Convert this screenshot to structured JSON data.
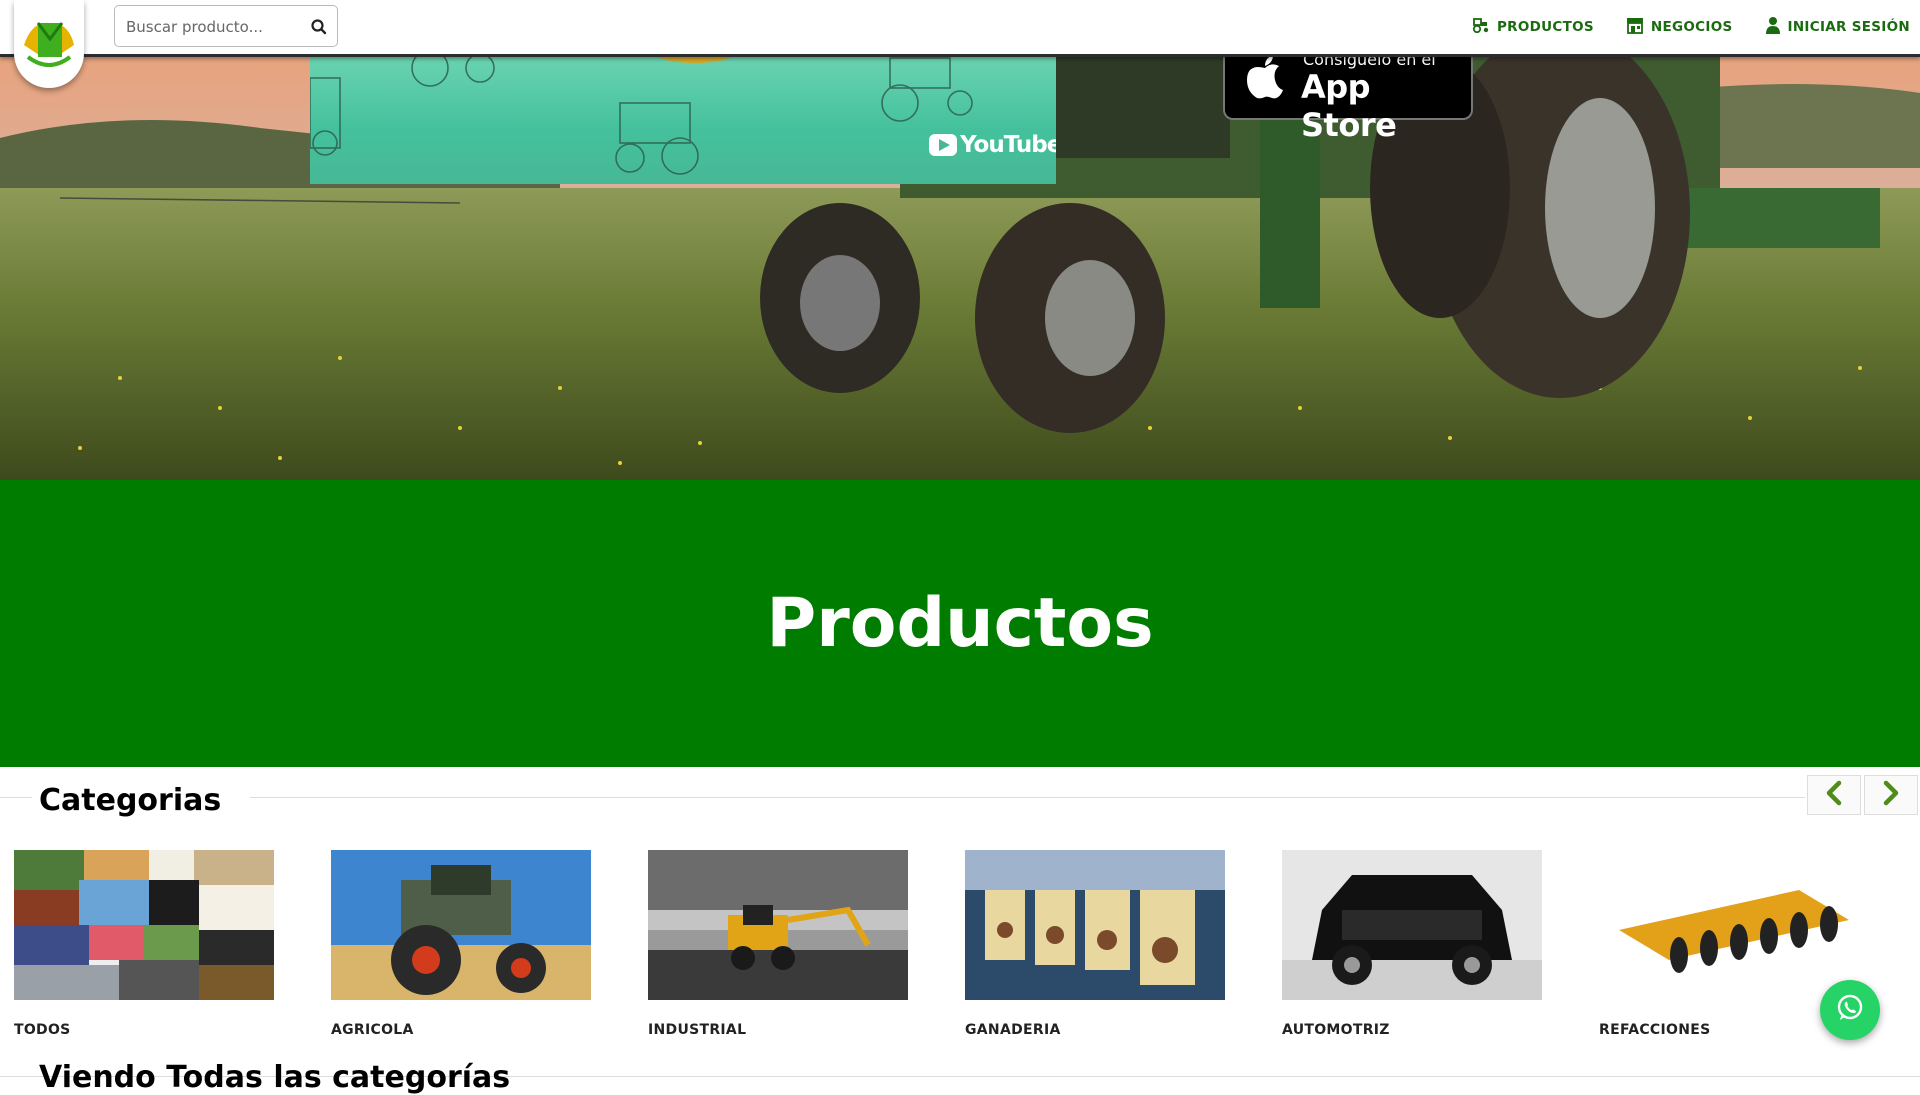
{
  "header": {
    "search_placeholder": "Buscar producto...",
    "nav": [
      {
        "label": "PRODUCTOS",
        "icon": "tractor-icon"
      },
      {
        "label": "NEGOCIOS",
        "icon": "store-icon"
      },
      {
        "label": "INICIAR SESIÓN",
        "icon": "user-icon"
      }
    ]
  },
  "hero": {
    "video_brand": "YouTube",
    "appstore_top": "Consíguelo en el",
    "appstore_main": "App Store"
  },
  "banner": {
    "title": "Productos"
  },
  "categories": {
    "heading": "Categorias",
    "items": [
      {
        "label": "TODOS"
      },
      {
        "label": "AGRICOLA"
      },
      {
        "label": "INDUSTRIAL"
      },
      {
        "label": "GANADERIA"
      },
      {
        "label": "AUTOMOTRIZ"
      },
      {
        "label": "REFACCIONES"
      }
    ]
  },
  "viewing": {
    "heading": "Viendo Todas las categorías"
  },
  "colors": {
    "brand_green": "#007c00",
    "nav_green": "#1a6b10",
    "whatsapp": "#25d366"
  }
}
